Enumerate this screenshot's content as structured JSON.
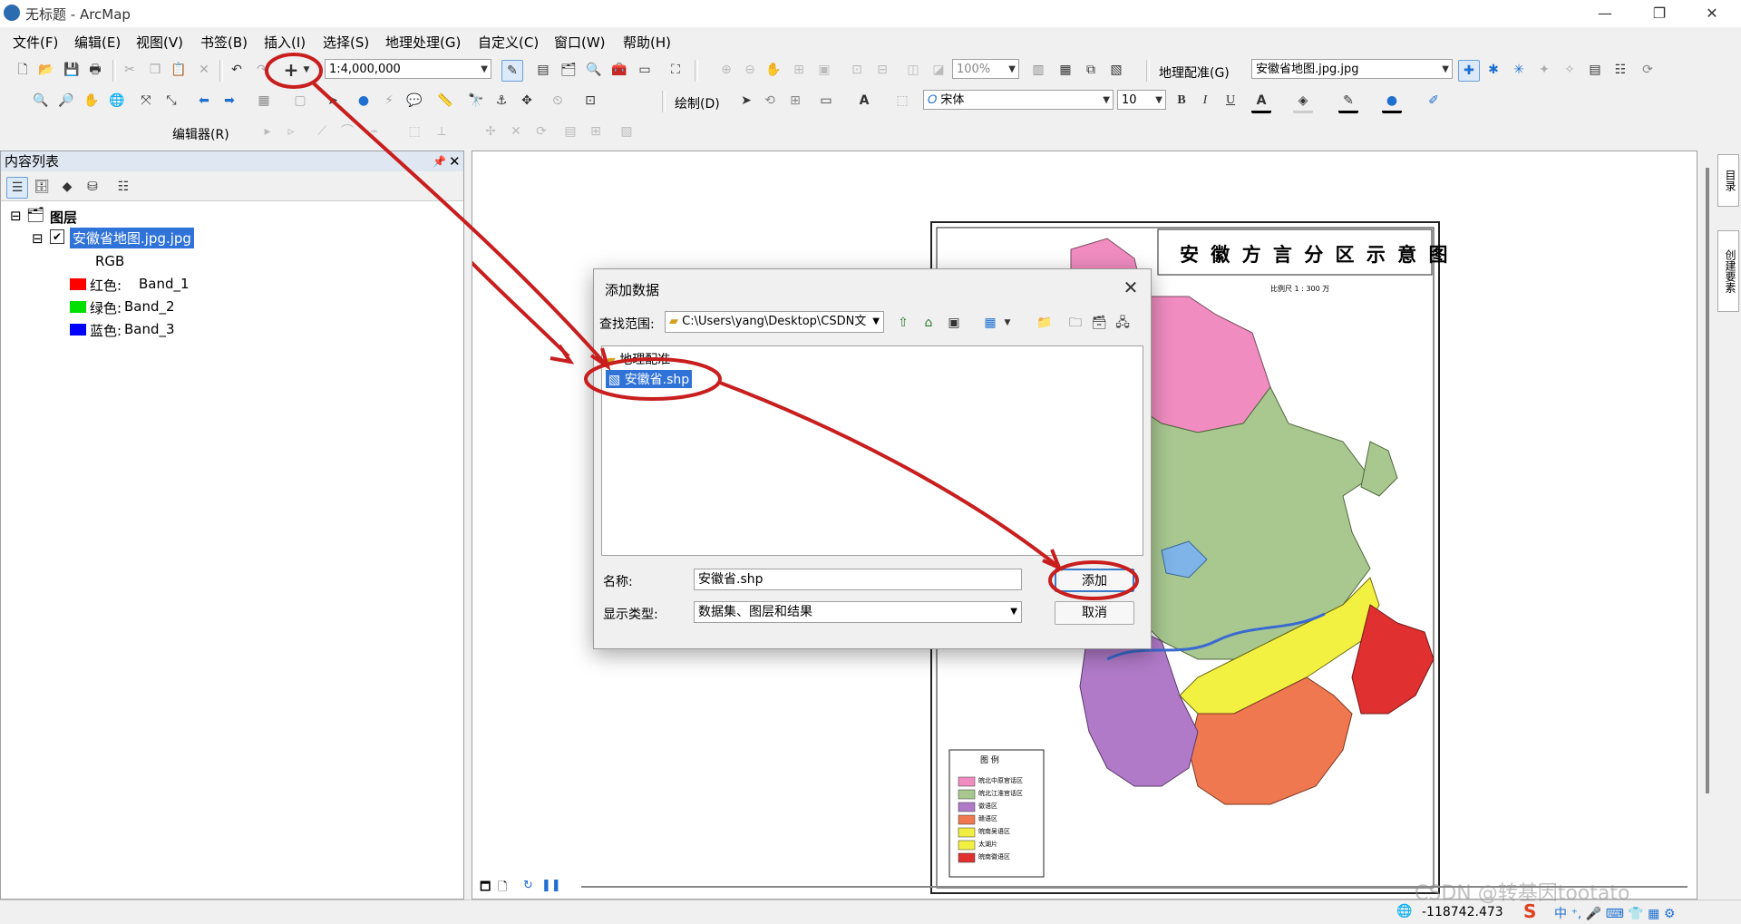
{
  "window": {
    "title": "无标题 - ArcMap",
    "min": "—",
    "restore": "❐",
    "close": "✕"
  },
  "menu": [
    "文件(F)",
    "编辑(E)",
    "视图(V)",
    "书签(B)",
    "插入(I)",
    "选择(S)",
    "地理处理(G)",
    "自定义(C)",
    "窗口(W)",
    "帮助(H)"
  ],
  "toolbar1": {
    "scale": "1:4,000,000",
    "zoom": "100%",
    "georef_label": "地理配准(G)",
    "georef_layer": "安徽省地图.jpg.jpg"
  },
  "toolbar2": {
    "draw_label": "绘制(D)",
    "font": "宋体",
    "fontsize": "10",
    "bold": "B",
    "italic": "I",
    "underline": "U"
  },
  "toolbar3": {
    "editor_label": "编辑器(R)"
  },
  "toc": {
    "title": "内容列表",
    "group": "图层",
    "layer": "安徽省地图.jpg.jpg",
    "rgb": "RGB",
    "bands": [
      {
        "label": "红色:",
        "band": "Band_1",
        "color": "#ff0000"
      },
      {
        "label": "绿色:",
        "band": "Band_2",
        "color": "#00e000"
      },
      {
        "label": "蓝色:",
        "band": "Band_3",
        "color": "#0000ff"
      }
    ]
  },
  "map": {
    "title": "安 徽 方 言 分 区 示 意 图",
    "scale_text": "比例尺 1 : 300 万",
    "legend_title": "图 例",
    "legend": [
      {
        "label": "皖北中原官话区",
        "color": "#f08cc0"
      },
      {
        "label": "皖北江淮官话区",
        "color": "#a8c890"
      },
      {
        "label": "徽语区",
        "color": "#b07ac8"
      },
      {
        "label": "赣语区",
        "color": "#f07850"
      },
      {
        "label": "皖南吴语区",
        "color": "#f0ee40"
      },
      {
        "label": "太湖片",
        "color": "#f2f040"
      },
      {
        "label": "皖南徽语区",
        "color": "#e03030"
      }
    ]
  },
  "dialog": {
    "title": "添加数据",
    "lookin_label": "查找范围:",
    "lookin_path": "C:\\Users\\yang\\Desktop\\CSDN文",
    "items": [
      {
        "name": "地理配准",
        "selected": false
      },
      {
        "name": "安徽省.shp",
        "selected": true
      }
    ],
    "name_label": "名称:",
    "name_value": "安徽省.shp",
    "type_label": "显示类型:",
    "type_value": "数据集、图层和结果",
    "add_label": "添加",
    "cancel_label": "取消"
  },
  "dock": {
    "tab1": "目录",
    "tab2": "创建要素"
  },
  "status": {
    "coords": "-118742.473",
    "watermark": "CSDN @转基因tootato"
  }
}
